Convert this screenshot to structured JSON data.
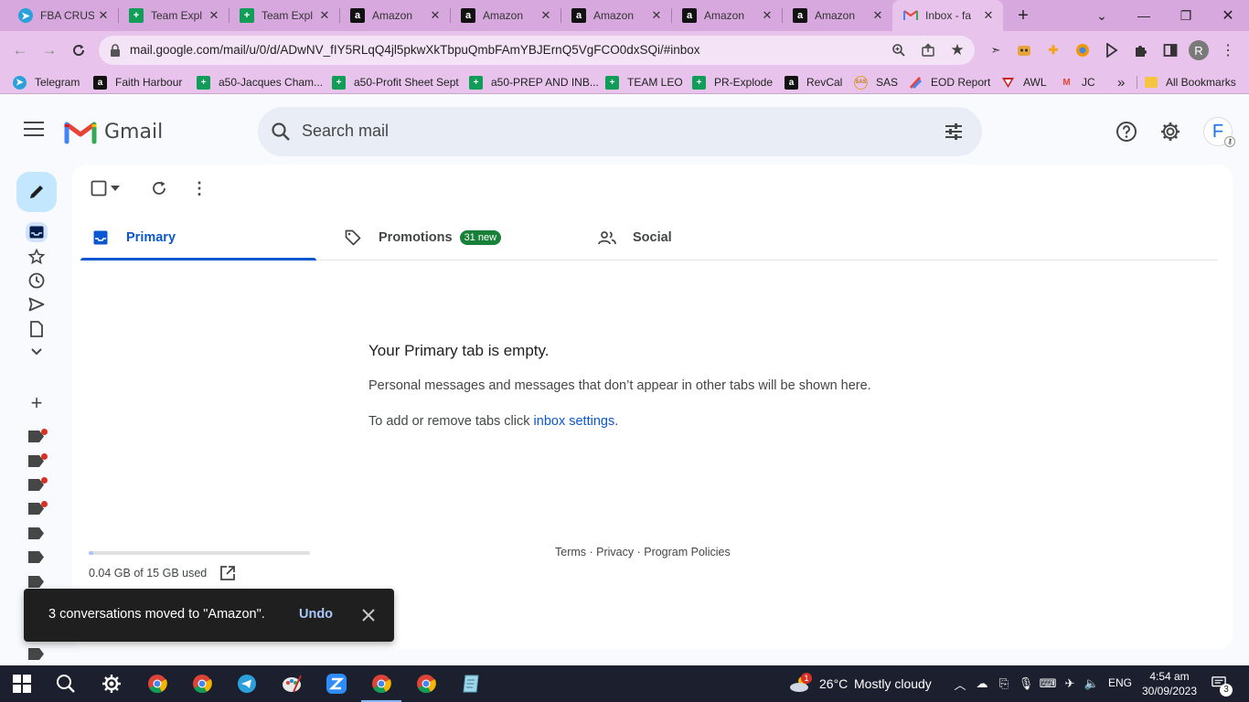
{
  "browser": {
    "tabs": [
      {
        "title": "FBA CRUS",
        "favicon": "telegram-icon"
      },
      {
        "title": "Team Expl",
        "favicon": "sheets-icon"
      },
      {
        "title": "Team Expl",
        "favicon": "sheets-icon"
      },
      {
        "title": "Amazon",
        "favicon": "amazon-icon"
      },
      {
        "title": "Amazon",
        "favicon": "amazon-icon"
      },
      {
        "title": "Amazon",
        "favicon": "amazon-icon"
      },
      {
        "title": "Amazon",
        "favicon": "amazon-icon"
      },
      {
        "title": "Amazon",
        "favicon": "amazon-icon"
      },
      {
        "title": "Inbox - fa",
        "favicon": "gmail-icon",
        "active": true
      }
    ],
    "url": "mail.google.com/mail/u/0/d/ADwNV_fIY5RLqQ4jl5pkwXkTbpuQmbFAmYBJErnQ5VgFCO0dxSQi/#inbox",
    "profile_initial": "R",
    "bookmarks": [
      {
        "label": "Telegram",
        "icon": "telegram-icon"
      },
      {
        "label": "Faith Harbour",
        "icon": "amazon-icon"
      },
      {
        "label": "a50-Jacques Cham...",
        "icon": "sheets-icon"
      },
      {
        "label": "a50-Profit Sheet Sept",
        "icon": "sheets-icon"
      },
      {
        "label": "a50-PREP AND INB...",
        "icon": "sheets-icon"
      },
      {
        "label": "TEAM LEO",
        "icon": "sheets-icon"
      },
      {
        "label": "PR-Explode",
        "icon": "sheets-icon"
      },
      {
        "label": "RevCal",
        "icon": "amazon-icon"
      },
      {
        "label": "SAS",
        "icon": "sas-icon"
      },
      {
        "label": "EOD Report",
        "icon": "eod-icon"
      },
      {
        "label": "AWL",
        "icon": "awl-icon"
      },
      {
        "label": "JC",
        "icon": "gmail-icon"
      }
    ],
    "bookmarks_overflow": "»",
    "all_bookmarks": "All Bookmarks"
  },
  "gmail": {
    "brand": "Gmail",
    "search_placeholder": "Search mail",
    "avatar_initial": "F",
    "tabs": [
      {
        "label": "Primary",
        "active": true
      },
      {
        "label": "Promotions",
        "badge": "31 new"
      },
      {
        "label": "Social"
      }
    ],
    "empty": {
      "title": "Your Primary tab is empty.",
      "line1": "Personal messages and messages that don’t appear in other tabs will be shown here.",
      "line2_prefix": "To add or remove tabs click ",
      "line2_link": "inbox settings",
      "line2_suffix": "."
    },
    "storage": {
      "text": "0.04 GB of 15 GB used",
      "fraction": 0.003
    },
    "footer": {
      "terms": "Terms",
      "privacy": "Privacy",
      "policies": "Program Policies",
      "sep": " · "
    },
    "snackbar": {
      "message": "3 conversations moved to \"Amazon\".",
      "undo": "Undo"
    }
  },
  "taskbar": {
    "weather_temp": "26°C",
    "weather_desc": "Mostly cloudy",
    "weather_badge": "1",
    "lang": "ENG",
    "time": "4:54 am",
    "date": "30/09/2023",
    "notifications": "3"
  },
  "colors": {
    "accent": "#0b57d0",
    "chrome": "#e8c4ed",
    "tabstrip": "#d7a8de",
    "badge": "#188038"
  }
}
